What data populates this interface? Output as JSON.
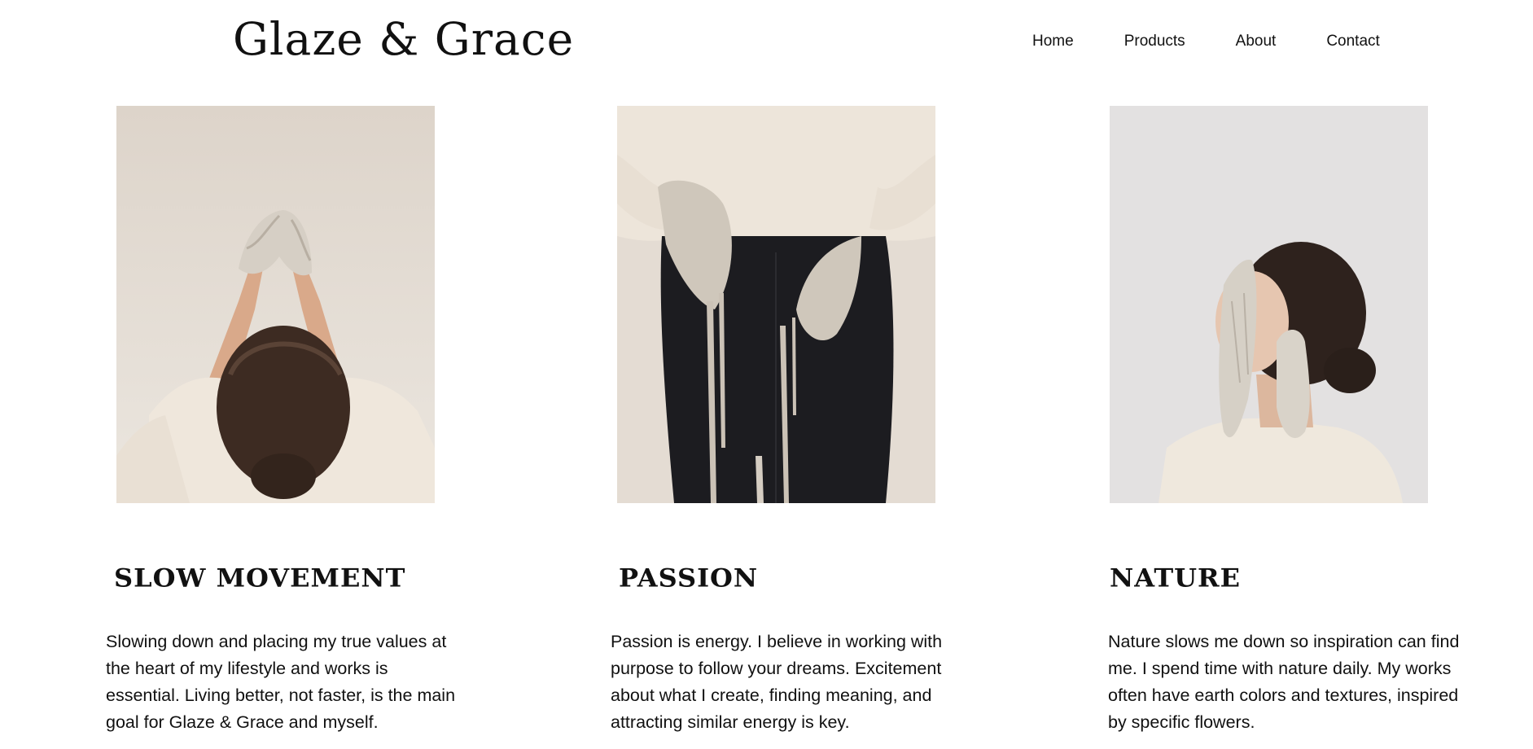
{
  "header": {
    "logo": "Glaze & Grace",
    "nav": [
      {
        "label": "Home"
      },
      {
        "label": "Products"
      },
      {
        "label": "About"
      },
      {
        "label": "Contact"
      }
    ]
  },
  "cards": [
    {
      "title": "SLOW MOVEMENT",
      "text": "Slowing down and placing my true values at the heart of my lifestyle and works is essential. Living better, not faster, is the main goal for Glaze & Grace and myself.",
      "image": "photo-raised-clay-hands"
    },
    {
      "title": "PASSION",
      "text": "Passion is energy. I believe in working with purpose to follow your dreams. Excitement about what I create, finding meaning, and attracting similar energy is key.",
      "image": "photo-dripping-clay-hands"
    },
    {
      "title": "NATURE",
      "text": "Nature slows me down so inspiration can find me. I spend time with nature daily. My works often have earth colors and textures, inspired by specific flowers.",
      "image": "photo-clay-hands-face"
    }
  ],
  "colors": {
    "background": "#ffffff",
    "text": "#111111",
    "photo_backdrop_warm": "#e7e1d9",
    "photo_backdrop_cool": "#e3e1e1",
    "sweater": "#efe8dd",
    "clay": "#cfc6ba",
    "hair": "#3b2a22",
    "jeans": "#1b1b1e"
  }
}
